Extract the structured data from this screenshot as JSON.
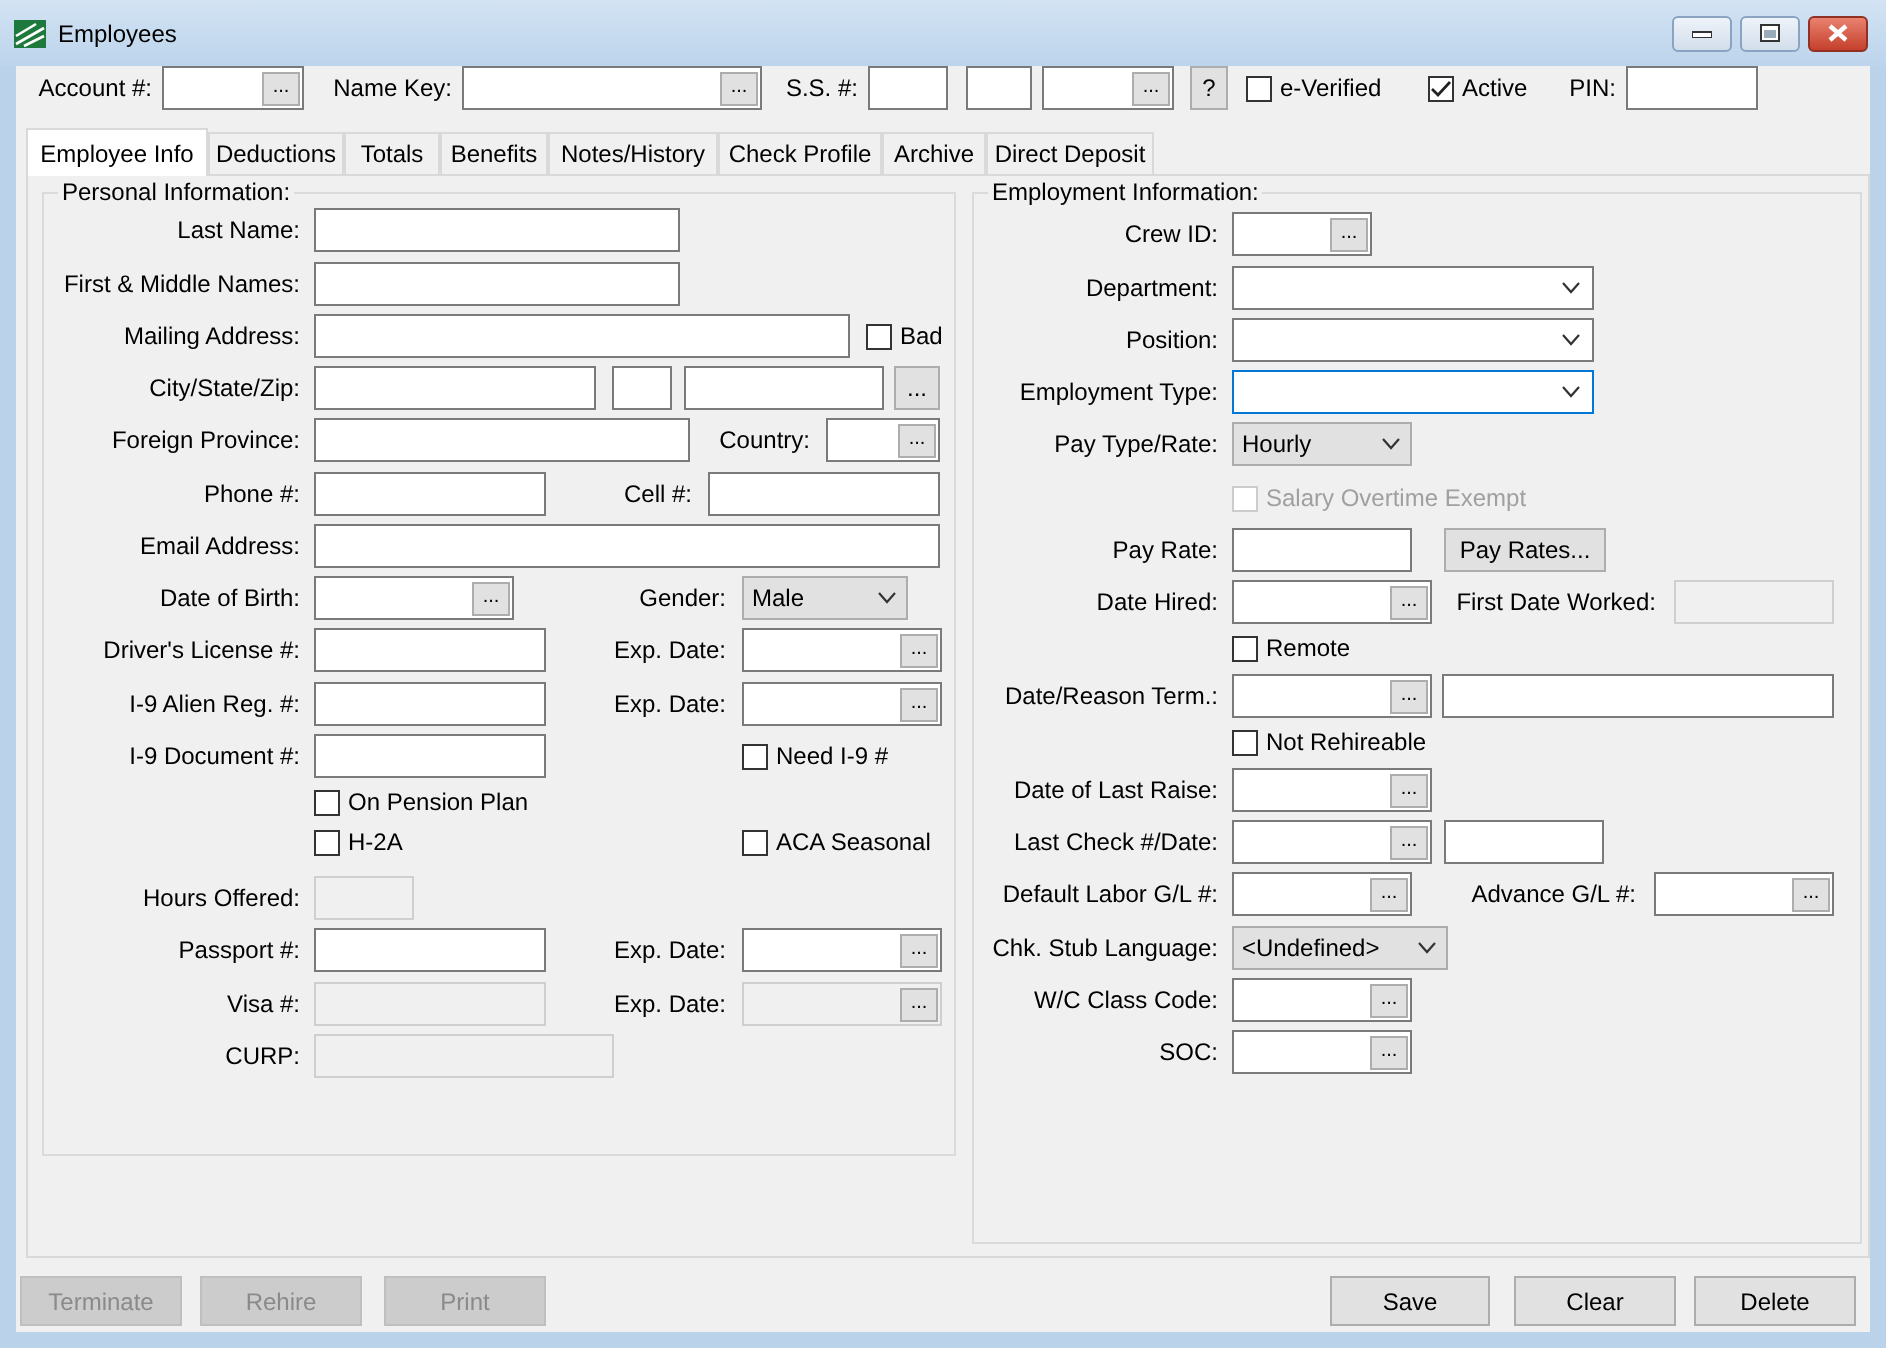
{
  "window": {
    "title": "Employees"
  },
  "header": [
    {
      "kind": "label",
      "text": "Account #:"
    },
    {
      "kind": "lookup",
      "button": "...",
      "disabled": false
    },
    {
      "kind": "label",
      "text": "Name Key:"
    },
    {
      "kind": "lookup",
      "button": "...",
      "disabled": false
    },
    {
      "kind": "label",
      "text": "S.S. #:"
    },
    {
      "kind": "text",
      "disabled": false
    },
    {
      "kind": "text",
      "disabled": false
    },
    {
      "kind": "lookup",
      "button": "...",
      "disabled": false
    },
    {
      "kind": "button",
      "label": "?",
      "disabled": false
    },
    {
      "kind": "checkbox",
      "label": "e-Verified",
      "checked": false,
      "disabled": false
    },
    {
      "kind": "checkbox",
      "label": "Active",
      "checked": true,
      "disabled": false
    },
    {
      "kind": "label",
      "text": "PIN:"
    },
    {
      "kind": "text",
      "disabled": false
    }
  ],
  "tabs": [
    {
      "label": "Employee Info",
      "selected": true
    },
    {
      "label": "Deductions",
      "selected": false
    },
    {
      "label": "Totals",
      "selected": false
    },
    {
      "label": "Benefits",
      "selected": false
    },
    {
      "label": "Notes/History",
      "selected": false
    },
    {
      "label": "Check Profile",
      "selected": false
    },
    {
      "label": "Archive",
      "selected": false
    },
    {
      "label": "Direct Deposit",
      "selected": false
    }
  ],
  "personal": {
    "legend": "Personal Information:",
    "rows": [
      {
        "items": [
          {
            "kind": "label",
            "text": "Last Name:"
          },
          {
            "kind": "text",
            "disabled": false
          }
        ]
      },
      {
        "items": [
          {
            "kind": "label",
            "text": "First & Middle Names:"
          },
          {
            "kind": "text",
            "disabled": false
          }
        ]
      },
      {
        "items": [
          {
            "kind": "label",
            "text": "Mailing Address:"
          },
          {
            "kind": "text",
            "disabled": false
          },
          {
            "kind": "checkbox",
            "label": "Bad",
            "checked": false,
            "disabled": false
          }
        ]
      },
      {
        "items": [
          {
            "kind": "label",
            "text": "City/State/Zip:"
          },
          {
            "kind": "text",
            "disabled": false
          },
          {
            "kind": "text",
            "disabled": false
          },
          {
            "kind": "text",
            "disabled": false
          },
          {
            "kind": "button",
            "label": "...",
            "disabled": false
          }
        ]
      },
      {
        "items": [
          {
            "kind": "label",
            "text": "Foreign Province:"
          },
          {
            "kind": "text",
            "disabled": false
          },
          {
            "kind": "label",
            "text": "Country:"
          },
          {
            "kind": "lookup",
            "button": "...",
            "disabled": false
          }
        ]
      },
      {
        "items": [
          {
            "kind": "label",
            "text": "Phone #:"
          },
          {
            "kind": "text",
            "disabled": false
          },
          {
            "kind": "label",
            "text": "Cell #:"
          },
          {
            "kind": "text",
            "disabled": false
          }
        ]
      },
      {
        "items": [
          {
            "kind": "label",
            "text": "Email Address:"
          },
          {
            "kind": "text",
            "disabled": false
          }
        ]
      },
      {
        "items": [
          {
            "kind": "label",
            "text": "Date of Birth:"
          },
          {
            "kind": "lookup",
            "button": "...",
            "disabled": false
          },
          {
            "kind": "label",
            "text": "Gender:"
          },
          {
            "kind": "dropdown",
            "value": "Male"
          }
        ]
      },
      {
        "items": [
          {
            "kind": "label",
            "text": "Driver's License #:"
          },
          {
            "kind": "text",
            "disabled": false
          },
          {
            "kind": "label",
            "text": "Exp. Date:"
          },
          {
            "kind": "lookup",
            "button": "...",
            "disabled": false
          }
        ]
      },
      {
        "items": [
          {
            "kind": "label",
            "text": "I-9 Alien Reg. #:"
          },
          {
            "kind": "text",
            "disabled": false
          },
          {
            "kind": "label",
            "text": "Exp. Date:"
          },
          {
            "kind": "lookup",
            "button": "...",
            "disabled": false
          }
        ]
      },
      {
        "items": [
          {
            "kind": "label",
            "text": "I-9 Document #:"
          },
          {
            "kind": "text",
            "disabled": false
          },
          {
            "kind": "checkbox",
            "label": "Need I-9 #",
            "checked": false,
            "disabled": false
          }
        ]
      },
      {
        "items": [
          {
            "kind": "checkbox",
            "label": "On Pension Plan",
            "checked": false,
            "disabled": false
          }
        ]
      },
      {
        "items": [
          {
            "kind": "checkbox",
            "label": "H-2A",
            "checked": false,
            "disabled": false
          },
          {
            "kind": "checkbox",
            "label": "ACA Seasonal",
            "checked": false,
            "disabled": false
          }
        ]
      },
      {
        "items": [
          {
            "kind": "label",
            "text": "Hours Offered:"
          },
          {
            "kind": "text",
            "disabled": true
          }
        ]
      },
      {
        "items": [
          {
            "kind": "label",
            "text": "Passport #:"
          },
          {
            "kind": "text",
            "disabled": false
          },
          {
            "kind": "label",
            "text": "Exp. Date:"
          },
          {
            "kind": "lookup",
            "button": "...",
            "disabled": false
          }
        ]
      },
      {
        "items": [
          {
            "kind": "label",
            "text": "Visa #:"
          },
          {
            "kind": "text",
            "disabled": true
          },
          {
            "kind": "label",
            "text": "Exp. Date:"
          },
          {
            "kind": "lookup",
            "button": "...",
            "disabled": true
          }
        ]
      },
      {
        "items": [
          {
            "kind": "label",
            "text": "CURP:"
          },
          {
            "kind": "text",
            "disabled": true
          }
        ]
      }
    ]
  },
  "employment": {
    "legend": "Employment Information:",
    "rows": [
      {
        "items": [
          {
            "kind": "label",
            "text": "Crew ID:"
          },
          {
            "kind": "lookup",
            "button": "...",
            "disabled": false
          }
        ]
      },
      {
        "items": [
          {
            "kind": "label",
            "text": "Department:"
          },
          {
            "kind": "combo",
            "focused": false
          }
        ]
      },
      {
        "items": [
          {
            "kind": "label",
            "text": "Position:"
          },
          {
            "kind": "combo",
            "focused": false
          }
        ]
      },
      {
        "items": [
          {
            "kind": "label",
            "text": "Employment Type:"
          },
          {
            "kind": "combo",
            "focused": true
          }
        ]
      },
      {
        "items": [
          {
            "kind": "label",
            "text": "Pay Type/Rate:"
          },
          {
            "kind": "dropdown",
            "value": "Hourly"
          }
        ]
      },
      {
        "items": [
          {
            "kind": "checkbox",
            "label": "Salary Overtime Exempt",
            "checked": false,
            "disabled": true
          }
        ]
      },
      {
        "items": [
          {
            "kind": "label",
            "text": "Pay Rate:"
          },
          {
            "kind": "text",
            "disabled": false
          },
          {
            "kind": "button",
            "label": "Pay Rates...",
            "disabled": false
          }
        ]
      },
      {
        "items": [
          {
            "kind": "label",
            "text": "Date Hired:"
          },
          {
            "kind": "lookup",
            "button": "...",
            "disabled": false
          },
          {
            "kind": "label",
            "text": "First Date Worked:"
          },
          {
            "kind": "text",
            "disabled": true
          }
        ]
      },
      {
        "items": [
          {
            "kind": "checkbox",
            "label": "Remote",
            "checked": false,
            "disabled": false
          }
        ]
      },
      {
        "items": [
          {
            "kind": "label",
            "text": "Date/Reason Term.:"
          },
          {
            "kind": "lookup",
            "button": "...",
            "disabled": false
          },
          {
            "kind": "text",
            "disabled": false
          }
        ]
      },
      {
        "items": [
          {
            "kind": "checkbox",
            "label": "Not Rehireable",
            "checked": false,
            "disabled": false
          }
        ]
      },
      {
        "items": [
          {
            "kind": "label",
            "text": "Date of Last Raise:"
          },
          {
            "kind": "lookup",
            "button": "...",
            "disabled": false
          }
        ]
      },
      {
        "items": [
          {
            "kind": "label",
            "text": "Last Check #/Date:"
          },
          {
            "kind": "lookup",
            "button": "...",
            "disabled": false
          },
          {
            "kind": "text",
            "disabled": false
          }
        ]
      },
      {
        "items": [
          {
            "kind": "label",
            "text": "Default Labor G/L #:"
          },
          {
            "kind": "lookup",
            "button": "...",
            "disabled": false
          },
          {
            "kind": "label",
            "text": "Advance G/L #:"
          },
          {
            "kind": "lookup",
            "button": "...",
            "disabled": false
          }
        ]
      },
      {
        "items": [
          {
            "kind": "label",
            "text": "Chk. Stub Language:"
          },
          {
            "kind": "dropdown",
            "value": "<Undefined>"
          }
        ]
      },
      {
        "items": [
          {
            "kind": "label",
            "text": "W/C Class Code:"
          },
          {
            "kind": "lookup",
            "button": "...",
            "disabled": false
          }
        ]
      },
      {
        "items": [
          {
            "kind": "label",
            "text": "SOC:"
          },
          {
            "kind": "lookup",
            "button": "...",
            "disabled": false
          }
        ]
      }
    ]
  },
  "left_buttons": [
    {
      "label": "Terminate",
      "disabled": true
    },
    {
      "label": "Rehire",
      "disabled": true
    },
    {
      "label": "Print",
      "disabled": true
    }
  ],
  "right_buttons": [
    {
      "label": "Save",
      "disabled": false
    },
    {
      "label": "Clear",
      "disabled": false
    },
    {
      "label": "Delete",
      "disabled": false
    }
  ]
}
